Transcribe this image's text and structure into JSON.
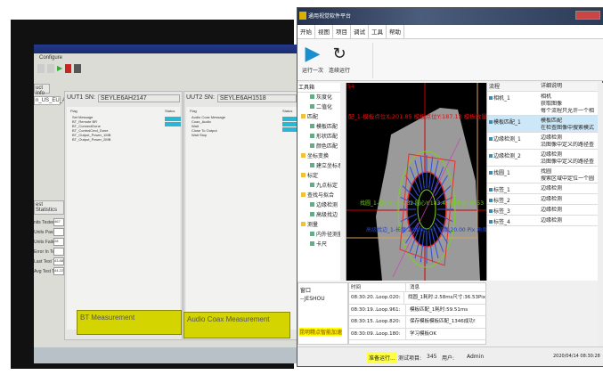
{
  "left_screen": {
    "menu": "Configure",
    "product_info_tab": "uct Info",
    "product_field": "n_US_EU_AP",
    "uut1": {
      "label": "UUT1  SN:",
      "sn": "SEYLE6AH2147",
      "col_flag": "Flag",
      "col_status": "Status",
      "items": [
        "Set Message",
        "BT_Remote BR",
        "BT_ConnectDone",
        "BT_ControlCmd_Done",
        "BT_Output_Power_1MB",
        "BT_Output_Power_2MB"
      ]
    },
    "uut2": {
      "label": "UUT2  SN:",
      "sn": "SEYLE6AH1518",
      "col_flag": "Flag",
      "col_status": "Status",
      "items": [
        "Audio Coax Message",
        "Coax_Audio",
        "Wait",
        "Close To Output",
        "Wait Stop"
      ]
    },
    "stats_title": "est Statistics",
    "stats": [
      {
        "label": "nits Tested:",
        "value": "467"
      },
      {
        "label": "Units Passed:",
        "value": ""
      },
      {
        "label": "Units Failed:",
        "value": "28"
      },
      {
        "label": "Error In Test:",
        "value": ""
      },
      {
        "label": "Last Test Time:",
        "value": "43.88"
      },
      {
        "label": "Avg Test Time:",
        "value": "44.22"
      }
    ],
    "bt_panel": "BT Measurement",
    "audio_panel": "Audio Coax Measurement",
    "status_color": "#2ab7d6",
    "panel_color": "#d4d400"
  },
  "app": {
    "title": "通用视觉软件平台",
    "menu": [
      "开始",
      "视图",
      "项目",
      "调试",
      "工具",
      "帮助"
    ],
    "ribbon": [
      {
        "label": "运行一次",
        "icon": "play-icon"
      },
      {
        "label": "连续运行",
        "icon": "loop-icon"
      }
    ],
    "toolbox_header": "工具箱",
    "toolbox": [
      {
        "label": "灰度化",
        "level": 2
      },
      {
        "label": "二值化",
        "level": 2
      },
      {
        "label": "匹配",
        "level": 1
      },
      {
        "label": "模板匹配",
        "level": 2
      },
      {
        "label": "形状匹配",
        "level": 2
      },
      {
        "label": "颜色匹配",
        "level": 2
      },
      {
        "label": "坐标变换",
        "level": 1
      },
      {
        "label": "建立坐标系",
        "level": 2
      },
      {
        "label": "标定",
        "level": 1
      },
      {
        "label": "九点标定",
        "level": 2
      },
      {
        "label": "查找与拟合",
        "level": 1
      },
      {
        "label": "边缘检测",
        "level": 2
      },
      {
        "label": "高级找边",
        "level": 2
      },
      {
        "label": "测量",
        "level": 1
      },
      {
        "label": "内外径测量",
        "level": 2
      },
      {
        "label": "卡尺",
        "level": 2
      }
    ],
    "view": {
      "corner": "54",
      "overlay1": "配_1-模板点位X:201.85 模板点位Y:187.13 模板数量",
      "overlay2": "找圆_1-圆心X:201.32 圆心Y:183.45 圆半径:39.53",
      "overlay3": "高级找边_1-长度:208.00 Pix 宽度:20.00 Pix 角度"
    },
    "flow_headers": [
      "流程",
      "详细说明"
    ],
    "flow": [
      {
        "name": "相机_1",
        "desc": [
          "相机",
          "获取图像",
          "每个流程只允许一个相"
        ]
      },
      {
        "name": "模板匹配_1",
        "desc": [
          "模板匹配",
          "在检查图像中搜索模式"
        ],
        "selected": true
      },
      {
        "name": "边缘检测_1",
        "desc": [
          "边缘检测",
          "沿图像中定义的路径查"
        ]
      },
      {
        "name": "边缘检测_2",
        "desc": [
          "边缘检测",
          "沿图像中定义的路径查"
        ]
      },
      {
        "name": "找圆_1",
        "desc": [
          "找圆",
          "搜索区域中定位一个圆"
        ]
      },
      {
        "name": "标签_1",
        "desc": [
          "边缘检测"
        ]
      },
      {
        "name": "标签_2",
        "desc": [
          "边缘检测"
        ]
      },
      {
        "name": "标签_3",
        "desc": [
          "边缘检测"
        ]
      },
      {
        "name": "标签_4",
        "desc": [
          "边缘检测"
        ]
      }
    ],
    "log_left": {
      "title": "窗口",
      "sub": "--JESHOU",
      "logo": "昆明精点智能加速"
    },
    "log_headers": [
      "时间",
      "消息"
    ],
    "log": [
      {
        "time": "08:30:20..Loop.020:",
        "msg": "找圆_1耗时:2.58ms尺寸:36.53Pix"
      },
      {
        "time": "08:30:19..Loop.961:",
        "msg": "模板匹配_1耗时:59.51ms"
      },
      {
        "time": "08:30:15..Loop.820:",
        "msg": "保存模板模板匹配_1346成功!"
      },
      {
        "time": "08:30:09..Loop.180:",
        "msg": "学习模板OK"
      }
    ],
    "status": {
      "state": "准备运行...",
      "project_label": "测试项目:",
      "project": "345",
      "user_label": "用户:",
      "user": "Admin",
      "datetime": "2020/04/14 08:30:28"
    },
    "colors": {
      "selected": "#cce8f8",
      "state_bg": "#ffff44",
      "play": "#1a8fd0"
    }
  }
}
